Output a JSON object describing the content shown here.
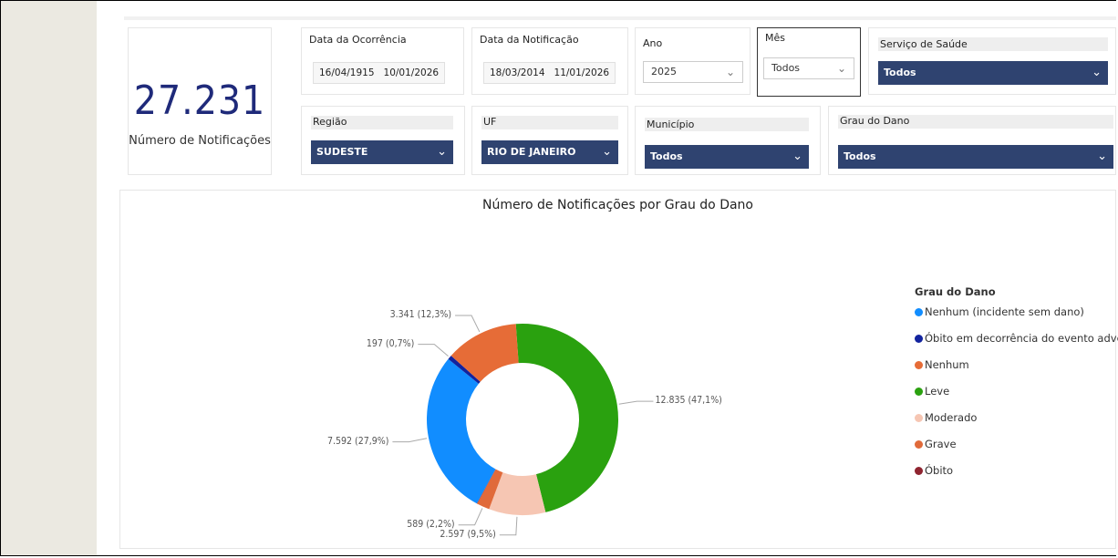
{
  "kpi": {
    "value": "27.231",
    "label": "Número de Notificações"
  },
  "filters": {
    "data_ocorrencia": {
      "title": "Data da Ocorrência",
      "start": "16/04/1915",
      "end": "10/01/2026"
    },
    "data_notificacao": {
      "title": "Data da Notificação",
      "start": "18/03/2014",
      "end": "11/01/2026"
    },
    "ano": {
      "title": "Ano",
      "value": "2025"
    },
    "mes": {
      "title": "Mês",
      "value": "Todos"
    },
    "servico": {
      "title": "Serviço de Saúde",
      "value": "Todos"
    },
    "regiao": {
      "title": "Região",
      "value": "SUDESTE"
    },
    "uf": {
      "title": "UF",
      "value": "RIO DE JANEIRO"
    },
    "municipio": {
      "title": "Município",
      "value": "Todos"
    },
    "grau": {
      "title": "Grau do Dano",
      "value": "Todos"
    }
  },
  "colors": {
    "navy": "#2f4370",
    "kpi_text": "#1f2a7a"
  },
  "chart_data": {
    "type": "pie",
    "title": "Número de Notificações por Grau do Dano",
    "slices": [
      {
        "name": "Leve",
        "value": 12835,
        "label": "12.835 (47,1%)",
        "color": "#2aa10f"
      },
      {
        "name": "Moderado",
        "value": 2597,
        "label": "2.597 (9,5%)",
        "color": "#f6c6b3"
      },
      {
        "name": "Grave",
        "value": 589,
        "label": "589 (2,2%)",
        "color": "#e06a3a"
      },
      {
        "name": "Óbito",
        "value": 20,
        "label": "",
        "color": "#8f2430"
      },
      {
        "name": "Nenhum (incidente sem dano)",
        "value": 7592,
        "label": "7.592 (27,9%)",
        "color": "#118dff"
      },
      {
        "name": "Óbito em decorrência do evento adverso",
        "value": 197,
        "label": "197 (0,7%)",
        "color": "#12239e"
      },
      {
        "name": "Nenhum",
        "value": 3341,
        "label": "3.341 (12,3%)",
        "color": "#e66c37"
      }
    ],
    "legend": {
      "title": "Grau do Dano",
      "position": "right",
      "items": [
        {
          "name": "Nenhum (incidente sem dano)",
          "color": "#118dff"
        },
        {
          "name": "Óbito em decorrência do evento adverso",
          "color": "#12239e"
        },
        {
          "name": "Nenhum",
          "color": "#e66c37"
        },
        {
          "name": "Leve",
          "color": "#2aa10f"
        },
        {
          "name": "Moderado",
          "color": "#f6c6b3"
        },
        {
          "name": "Grave",
          "color": "#e06a3a"
        },
        {
          "name": "Óbito",
          "color": "#8f2430"
        }
      ]
    }
  }
}
